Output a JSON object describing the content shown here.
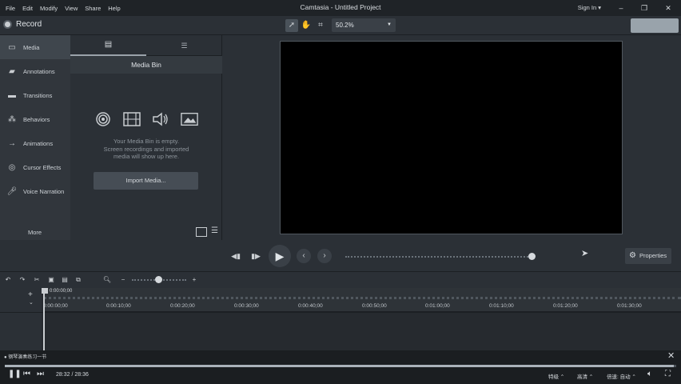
{
  "titlebar": {
    "menu": [
      "File",
      "Edit",
      "Modify",
      "View",
      "Share",
      "Help"
    ],
    "title": "Camtasia - Untitled Project",
    "signin": "Sign In ▾"
  },
  "toolbar": {
    "record_label": "Record",
    "zoom_value": "50.2%"
  },
  "sidebar": {
    "items": [
      {
        "label": "Media",
        "icon": "media-icon"
      },
      {
        "label": "Annotations",
        "icon": "annotations-icon"
      },
      {
        "label": "Transitions",
        "icon": "transitions-icon"
      },
      {
        "label": "Behaviors",
        "icon": "behaviors-icon"
      },
      {
        "label": "Animations",
        "icon": "animations-icon"
      },
      {
        "label": "Cursor Effects",
        "icon": "cursor-effects-icon"
      },
      {
        "label": "Voice Narration",
        "icon": "voice-narration-icon"
      }
    ],
    "more_label": "More"
  },
  "media_bin": {
    "header": "Media Bin",
    "empty_line1": "Your Media Bin is empty.",
    "empty_line2": "Screen recordings and imported",
    "empty_line3": "media will show up here.",
    "import_label": "Import Media..."
  },
  "properties_label": "Properties",
  "timeline": {
    "playhead_time": "0:00:00;00",
    "ticks": [
      "0:00:00;00",
      "0:00:10;00",
      "0:00:20;00",
      "0:00:30;00",
      "0:00:40;00",
      "0:00:50;00",
      "0:01:00;00",
      "0:01:10;00",
      "0:01:20;00",
      "0:01:30;00"
    ]
  },
  "overlay": {
    "title": "● 钢琴演奏练习一节",
    "time": "28:32 / 28:36",
    "progress": 0.996,
    "options": [
      "特级 ⌃",
      "高清 ⌃",
      "倍速: 自动 ⌃"
    ]
  },
  "colors": {
    "background": "#2b3036",
    "canvas": "#000000",
    "titlebar": "#1f2327"
  }
}
